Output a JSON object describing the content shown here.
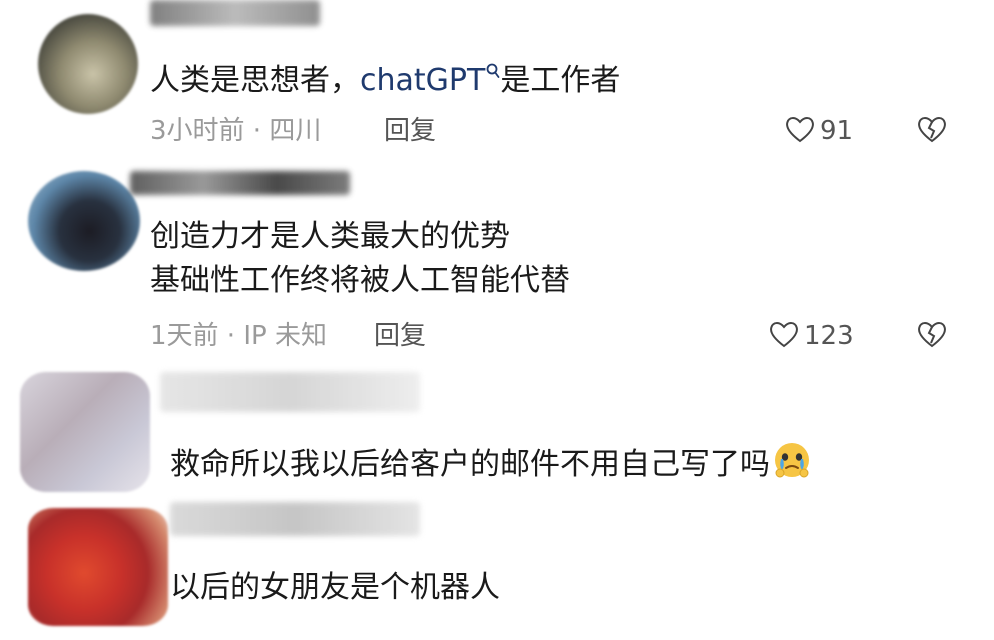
{
  "comments": [
    {
      "lines": [
        "人类是思想者，",
        "chatGPT",
        "是工作者"
      ],
      "meta": "3小时前 · 四川",
      "reply": "回复",
      "likes": "91",
      "icons": {
        "like": "heart-outline-icon",
        "dislike": "broken-heart-icon",
        "search": "search-icon"
      }
    },
    {
      "lines": [
        "创造力才是人类最大的优势",
        "基础性工作终将被人工智能代替"
      ],
      "meta": "1天前 · IP 未知",
      "reply": "回复",
      "likes": "123",
      "icons": {
        "like": "heart-outline-icon",
        "dislike": "broken-heart-icon"
      }
    },
    {
      "lines": [
        "救命所以我以后给客户的邮件不用自己写了吗"
      ],
      "emoji": "crying-face-emoji"
    },
    {
      "lines": [
        "以后的女朋友是个机器人"
      ]
    }
  ],
  "colors": {
    "text": "#1a1a1a",
    "link": "#1f3a6e",
    "meta": "#9a9a9a",
    "background": "#ffffff"
  }
}
